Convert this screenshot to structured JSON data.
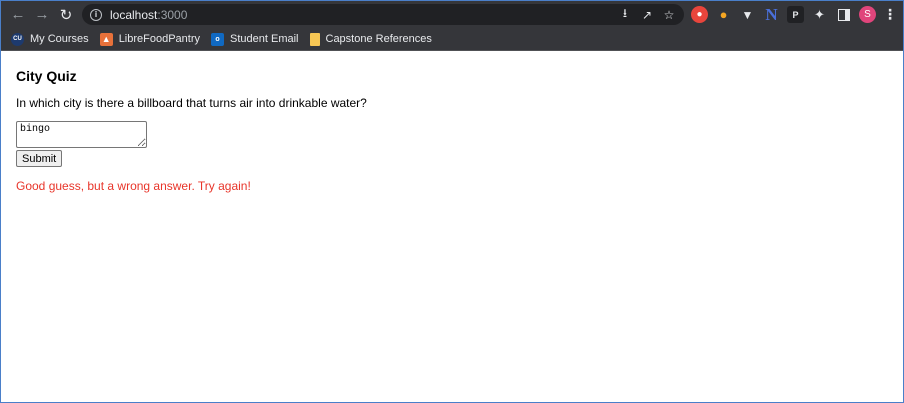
{
  "browser": {
    "url_host": "localhost",
    "url_port": ":3000",
    "icons": {
      "back": "back-arrow-icon",
      "forward": "forward-arrow-icon",
      "reload": "reload-icon",
      "site_info": "info-icon",
      "install": "install-app-icon",
      "share": "share-icon",
      "bookmark": "star-icon",
      "extensions": "puzzle-icon",
      "side_panel": "side-panel-icon",
      "menu": "kebab-menu-icon"
    },
    "avatar_letter": "S",
    "extension_p_label": "P",
    "extension_n_label": "N",
    "bookmarks": [
      {
        "label": "My Courses",
        "icon": "cu-logo-icon"
      },
      {
        "label": "LibreFoodPantry",
        "icon": "gitlab-fox-icon"
      },
      {
        "label": "Student Email",
        "icon": "outlook-icon"
      },
      {
        "label": "Capstone References",
        "icon": "folder-icon"
      }
    ],
    "cu_icon_text": "CU",
    "outlook_icon_text": "o"
  },
  "quiz": {
    "title": "City Quiz",
    "question": "In which city is there a billboard that turns air into drinkable water?",
    "answer_value": "bingo",
    "submit_label": "Submit",
    "feedback": "Good guess, but a wrong answer. Try again!"
  },
  "colors": {
    "chrome_bg": "#35363a",
    "omnibox_bg": "#202124",
    "feedback_text": "#e8352a",
    "avatar_bg": "#e0457b"
  }
}
